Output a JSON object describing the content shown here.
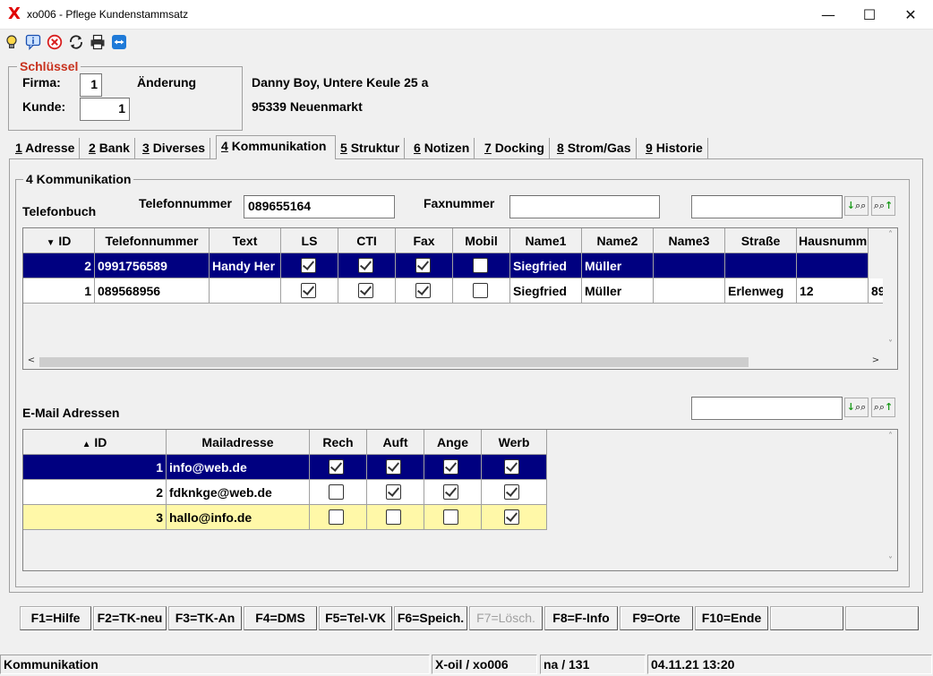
{
  "window": {
    "app_icon": "X",
    "title": "xo006 - Pflege Kundenstammsatz",
    "minimize": "—",
    "maximize": "☐",
    "close": "✕"
  },
  "toolbar": {
    "icons": [
      "lightbulb-icon",
      "info-icon",
      "cancel-icon",
      "refresh-icon",
      "print-icon",
      "teamviewer-icon"
    ]
  },
  "key": {
    "legend": "Schlüssel",
    "firma_label": "Firma:",
    "firma_value": "1",
    "kunde_label": "Kunde:",
    "kunde_value": "1",
    "mode": "Änderung",
    "address_line1": "Danny Boy, Untere Keule 25 a",
    "address_line2": "95339 Neuenmarkt"
  },
  "tabs": [
    {
      "num": "1",
      "label": "Adresse"
    },
    {
      "num": "2",
      "label": "Bank"
    },
    {
      "num": "3",
      "label": "Diverses"
    },
    {
      "num": "4",
      "label": "Kommunikation"
    },
    {
      "num": "5",
      "label": "Struktur"
    },
    {
      "num": "6",
      "label": "Notizen"
    },
    {
      "num": "7",
      "label": "Docking"
    },
    {
      "num": "8",
      "label": "Strom/Gas"
    },
    {
      "num": "9",
      "label": "Historie"
    }
  ],
  "panel": {
    "legend": "4 Kommunikation",
    "telefonbuch_label": "Telefonbuch",
    "telefonnummer_label": "Telefonnummer",
    "telefonnummer_value": "089655164",
    "faxnummer_label": "Faxnummer",
    "faxnummer_value": "",
    "search_value": "",
    "search_down": "↓",
    "search_up": "↑",
    "search_glyph": "⌕⌕"
  },
  "phone_grid": {
    "sort_arrow": "▼",
    "columns": [
      "ID",
      "Telefonnummer",
      "Text",
      "LS",
      "CTI",
      "Fax",
      "Mobil",
      "Name1",
      "Name2",
      "Name3",
      "Straße",
      "Hausnumm"
    ],
    "rows": [
      {
        "id": "2",
        "telefonnummer": "0991756589",
        "text": "Handy Her",
        "ls": true,
        "cti": true,
        "fax": true,
        "mobil": false,
        "name1": "Siegfried",
        "name2": "Müller",
        "name3": "",
        "strasse": "",
        "hausnummer": "",
        "extra": ""
      },
      {
        "id": "1",
        "telefonnummer": "089568956",
        "text": "",
        "ls": true,
        "cti": true,
        "fax": true,
        "mobil": false,
        "name1": "Siegfried",
        "name2": "Müller",
        "name3": "",
        "strasse": "Erlenweg",
        "hausnummer": "12",
        "extra": "89"
      }
    ],
    "scroll_up": "˄",
    "scroll_down": "˅",
    "scroll_left": "<",
    "scroll_right": ">"
  },
  "email": {
    "label": "E-Mail Adressen",
    "search_value": "",
    "sort_arrow": "▲",
    "columns": [
      "ID",
      "Mailadresse",
      "Rech",
      "Auft",
      "Ange",
      "Werb"
    ],
    "rows": [
      {
        "id": "1",
        "mail": "info@web.de",
        "rech": true,
        "auft": true,
        "ange": true,
        "werb": true
      },
      {
        "id": "2",
        "mail": "fdknkge@web.de",
        "rech": false,
        "auft": true,
        "ange": true,
        "werb": true
      },
      {
        "id": "3",
        "mail": "hallo@info.de",
        "rech": false,
        "auft": false,
        "ange": false,
        "werb": true
      }
    ]
  },
  "fkeys": [
    "F1=Hilfe",
    "F2=TK-neu",
    "F3=TK-An",
    "F4=DMS",
    "F5=Tel-VK",
    "F6=Speich.",
    "F7=Lösch.",
    "F8=F-Info",
    "F9=Orte",
    "F10=Ende",
    "",
    ""
  ],
  "statusbar": {
    "section": "Kommunikation",
    "program": "X-oil / xo006",
    "user": "na / 131",
    "datetime": "04.11.21 13:20"
  },
  "colors": {
    "selection": "#000080",
    "highlight_row": "#fff8a8",
    "legend": "#c8321e",
    "app_icon": "#e00000"
  }
}
